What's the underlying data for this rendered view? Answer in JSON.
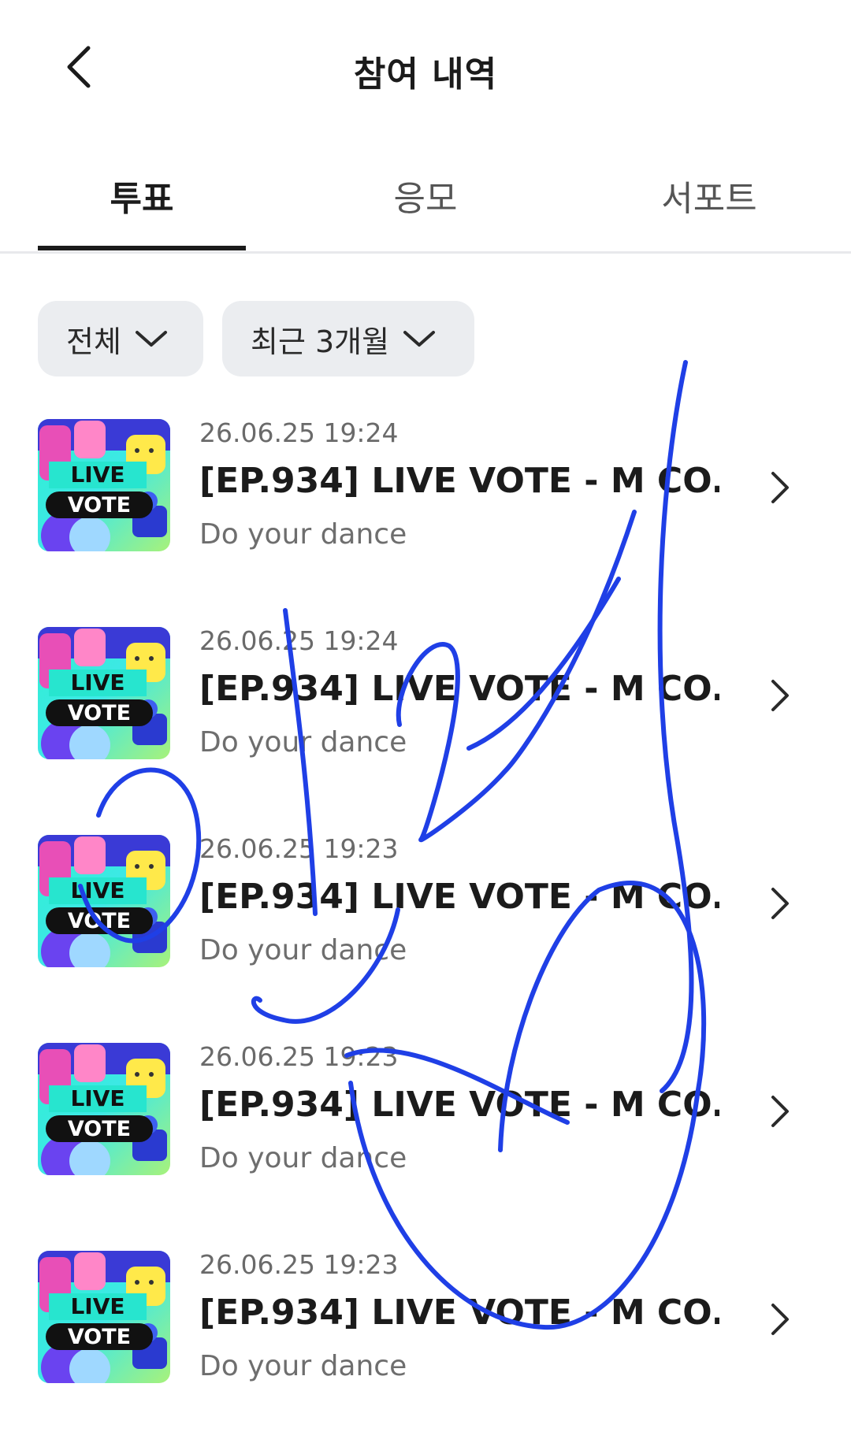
{
  "header": {
    "title": "참여 내역",
    "back_icon": "chevron-left-icon"
  },
  "tabs": [
    {
      "label": "투표",
      "active": true
    },
    {
      "label": "응모",
      "active": false
    },
    {
      "label": "서포트",
      "active": false
    }
  ],
  "filters": {
    "type": "전체",
    "period": "최근 3개월"
  },
  "thumbnail": {
    "line1": "LIVE",
    "line2": "VOTE"
  },
  "items": [
    {
      "date": "26.06.25 19:24",
      "title": "[EP.934] LIVE VOTE - M CO...",
      "subtitle": "Do your dance"
    },
    {
      "date": "26.06.25 19:24",
      "title": "[EP.934] LIVE VOTE - M CO...",
      "subtitle": "Do your dance"
    },
    {
      "date": "26.06.25 19:23",
      "title": "[EP.934] LIVE VOTE - M CO...",
      "subtitle": "Do your dance"
    },
    {
      "date": "26.06.25 19:23",
      "title": "[EP.934] LIVE VOTE - M CO...",
      "subtitle": "Do your dance"
    },
    {
      "date": "26.06.25 19:23",
      "title": "[EP.934] LIVE VOTE - M CO...",
      "subtitle": "Do your dance"
    }
  ],
  "colors": {
    "accent": "#1b1b1b",
    "filter_bg": "#ebedf0",
    "scribble": "#1f3fe6"
  }
}
